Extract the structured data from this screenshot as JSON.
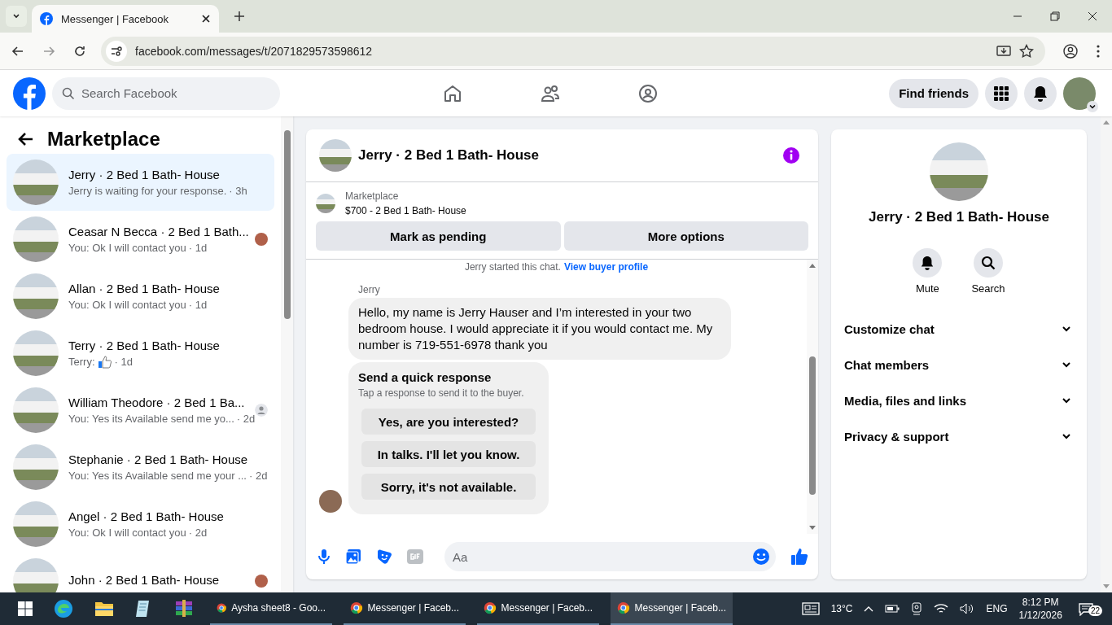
{
  "browser": {
    "tab_title": "Messenger | Facebook",
    "url": "facebook.com/messages/t/2071829573598612"
  },
  "header": {
    "search_placeholder": "Search Facebook",
    "find_friends": "Find friends"
  },
  "sidebar": {
    "title": "Marketplace",
    "conversations": [
      {
        "name": "Jerry · 2 Bed 1 Bath- House",
        "preview": "Jerry is waiting for your response.",
        "like": false,
        "time": "· 3h",
        "kind": "plain",
        "selected": true
      },
      {
        "name": "Ceasar N Becca · 2 Bed 1 Bath...",
        "preview": "You: Ok I will contact you",
        "like": false,
        "time": "· 1d",
        "kind": "photo_receipt",
        "selected": false
      },
      {
        "name": "Allan · 2 Bed 1 Bath- House",
        "preview": "You: Ok I will contact you",
        "like": false,
        "time": "· 1d",
        "kind": "plain",
        "selected": false
      },
      {
        "name": "Terry · 2 Bed 1 Bath- House",
        "preview": "Terry:",
        "like": true,
        "time": "· 1d",
        "kind": "plain",
        "selected": false
      },
      {
        "name": "William Theodore · 2 Bed 1 Ba...",
        "preview": "You: Yes its Available send me yo...",
        "like": false,
        "time": "· 2d",
        "kind": "person_receipt",
        "selected": false
      },
      {
        "name": "Stephanie · 2 Bed 1 Bath- House",
        "preview": "You: Yes its Available send me your ...",
        "like": false,
        "time": "· 2d",
        "kind": "plain",
        "selected": false
      },
      {
        "name": "Angel · 2 Bed 1 Bath- House",
        "preview": "You: Ok I will contact you",
        "like": false,
        "time": "· 2d",
        "kind": "plain",
        "selected": false
      },
      {
        "name": "John · 2 Bed 1 Bath- House",
        "like": false,
        "kind": "photo_receipt",
        "selected": false
      }
    ]
  },
  "chat": {
    "title": "Jerry · 2 Bed 1 Bath- House",
    "listing_label": "Marketplace",
    "listing_title": "$700 - 2 Bed 1 Bath- House",
    "actions": [
      "Mark as pending",
      "More options"
    ],
    "notice": "Jerry started this chat.",
    "notice_link": "View buyer profile",
    "sender": "Jerry",
    "message": "Hello, my name is Jerry Hauser and I’m interested in your two bedroom house. I would appreciate it if you would contact me. My number is 719-551-6978 thank you",
    "quick_title": "Send a quick response",
    "quick_subtitle": "Tap a response to send it to the buyer.",
    "quick_options": [
      "Yes, are you interested?",
      "In talks. I'll let you know.",
      "Sorry, it's not available."
    ],
    "composer_placeholder": "Aa"
  },
  "details": {
    "name": "Jerry · 2 Bed 1 Bath- House",
    "actions": [
      {
        "kind": "mute",
        "label": "Mute"
      },
      {
        "kind": "search",
        "label": "Search"
      }
    ],
    "sections": [
      "Customize chat",
      "Chat members",
      "Media, files and links",
      "Privacy & support"
    ]
  },
  "taskbar": {
    "apps": [
      {
        "kind": "edge"
      },
      {
        "kind": "folder"
      },
      {
        "kind": "notepad"
      },
      {
        "kind": "archive"
      }
    ],
    "windows": [
      {
        "label": "Aysha sheet8 - Goo...",
        "selected": false
      },
      {
        "label": "Messenger | Faceb...",
        "selected": false
      },
      {
        "label": "Messenger | Faceb...",
        "selected": false
      },
      {
        "label": "Messenger | Faceb...",
        "selected": true
      }
    ],
    "temperature": "13°C",
    "language": "ENG",
    "time": "8:12 PM",
    "date": "1/12/2026",
    "notifications": "22"
  }
}
